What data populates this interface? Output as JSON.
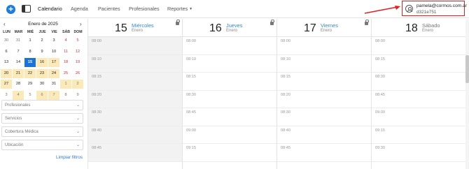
{
  "header": {
    "nav": [
      "Calendario",
      "Agenda",
      "Pacientes",
      "Profesionales",
      "Reportes"
    ],
    "user": {
      "email": "pamela@cormos.com.ar",
      "id": "d321e751"
    }
  },
  "calendar": {
    "prev": "‹",
    "next": "›",
    "title": "Enero de 2025",
    "weekdays": [
      "LUN",
      "MAR",
      "MIÉ",
      "JUE",
      "VIE",
      "SÁB",
      "DOM"
    ],
    "weeks": [
      [
        "30",
        "31",
        "1",
        "2",
        "3",
        "4",
        "5"
      ],
      [
        "6",
        "7",
        "8",
        "9",
        "10",
        "11",
        "12"
      ],
      [
        "13",
        "14",
        "15",
        "16",
        "17",
        "18",
        "19"
      ],
      [
        "20",
        "21",
        "22",
        "23",
        "24",
        "25",
        "26"
      ],
      [
        "27",
        "28",
        "29",
        "30",
        "31",
        "1",
        "2"
      ],
      [
        "3",
        "4",
        "5",
        "6",
        "7",
        "8",
        "9"
      ]
    ],
    "selected": "15"
  },
  "filters": [
    {
      "label": "Profesionales"
    },
    {
      "label": "Servicios"
    },
    {
      "label": "Cobertura Médica"
    },
    {
      "label": "Ubicación"
    }
  ],
  "clear_filters": "Limpiar filtros",
  "columns": [
    {
      "num": "15",
      "day": "Miércoles",
      "month": "Enero",
      "times": [
        "08:00",
        "08:10",
        "08:15",
        "08:20",
        "08:30",
        "08:40",
        "08:45"
      ]
    },
    {
      "num": "16",
      "day": "Jueves",
      "month": "Enero",
      "times": [
        "08:00",
        "08:10",
        "08:15",
        "08:30",
        "08:45",
        "09:00",
        "09:15"
      ]
    },
    {
      "num": "17",
      "day": "Viernes",
      "month": "Enero",
      "times": [
        "08:00",
        "08:10",
        "08:15",
        "08:20",
        "08:30",
        "08:40",
        "08:45"
      ]
    },
    {
      "num": "18",
      "day": "Sábado",
      "month": "Enero",
      "times": [
        "08:00",
        "08:15",
        "08:30",
        "08:45",
        "09:00",
        "09:15",
        "09:30"
      ]
    }
  ],
  "colors": {
    "accent": "#1a7de0",
    "highlight": "#fbe9b8",
    "weekend": "#d03030",
    "annotation": "#e02020"
  }
}
